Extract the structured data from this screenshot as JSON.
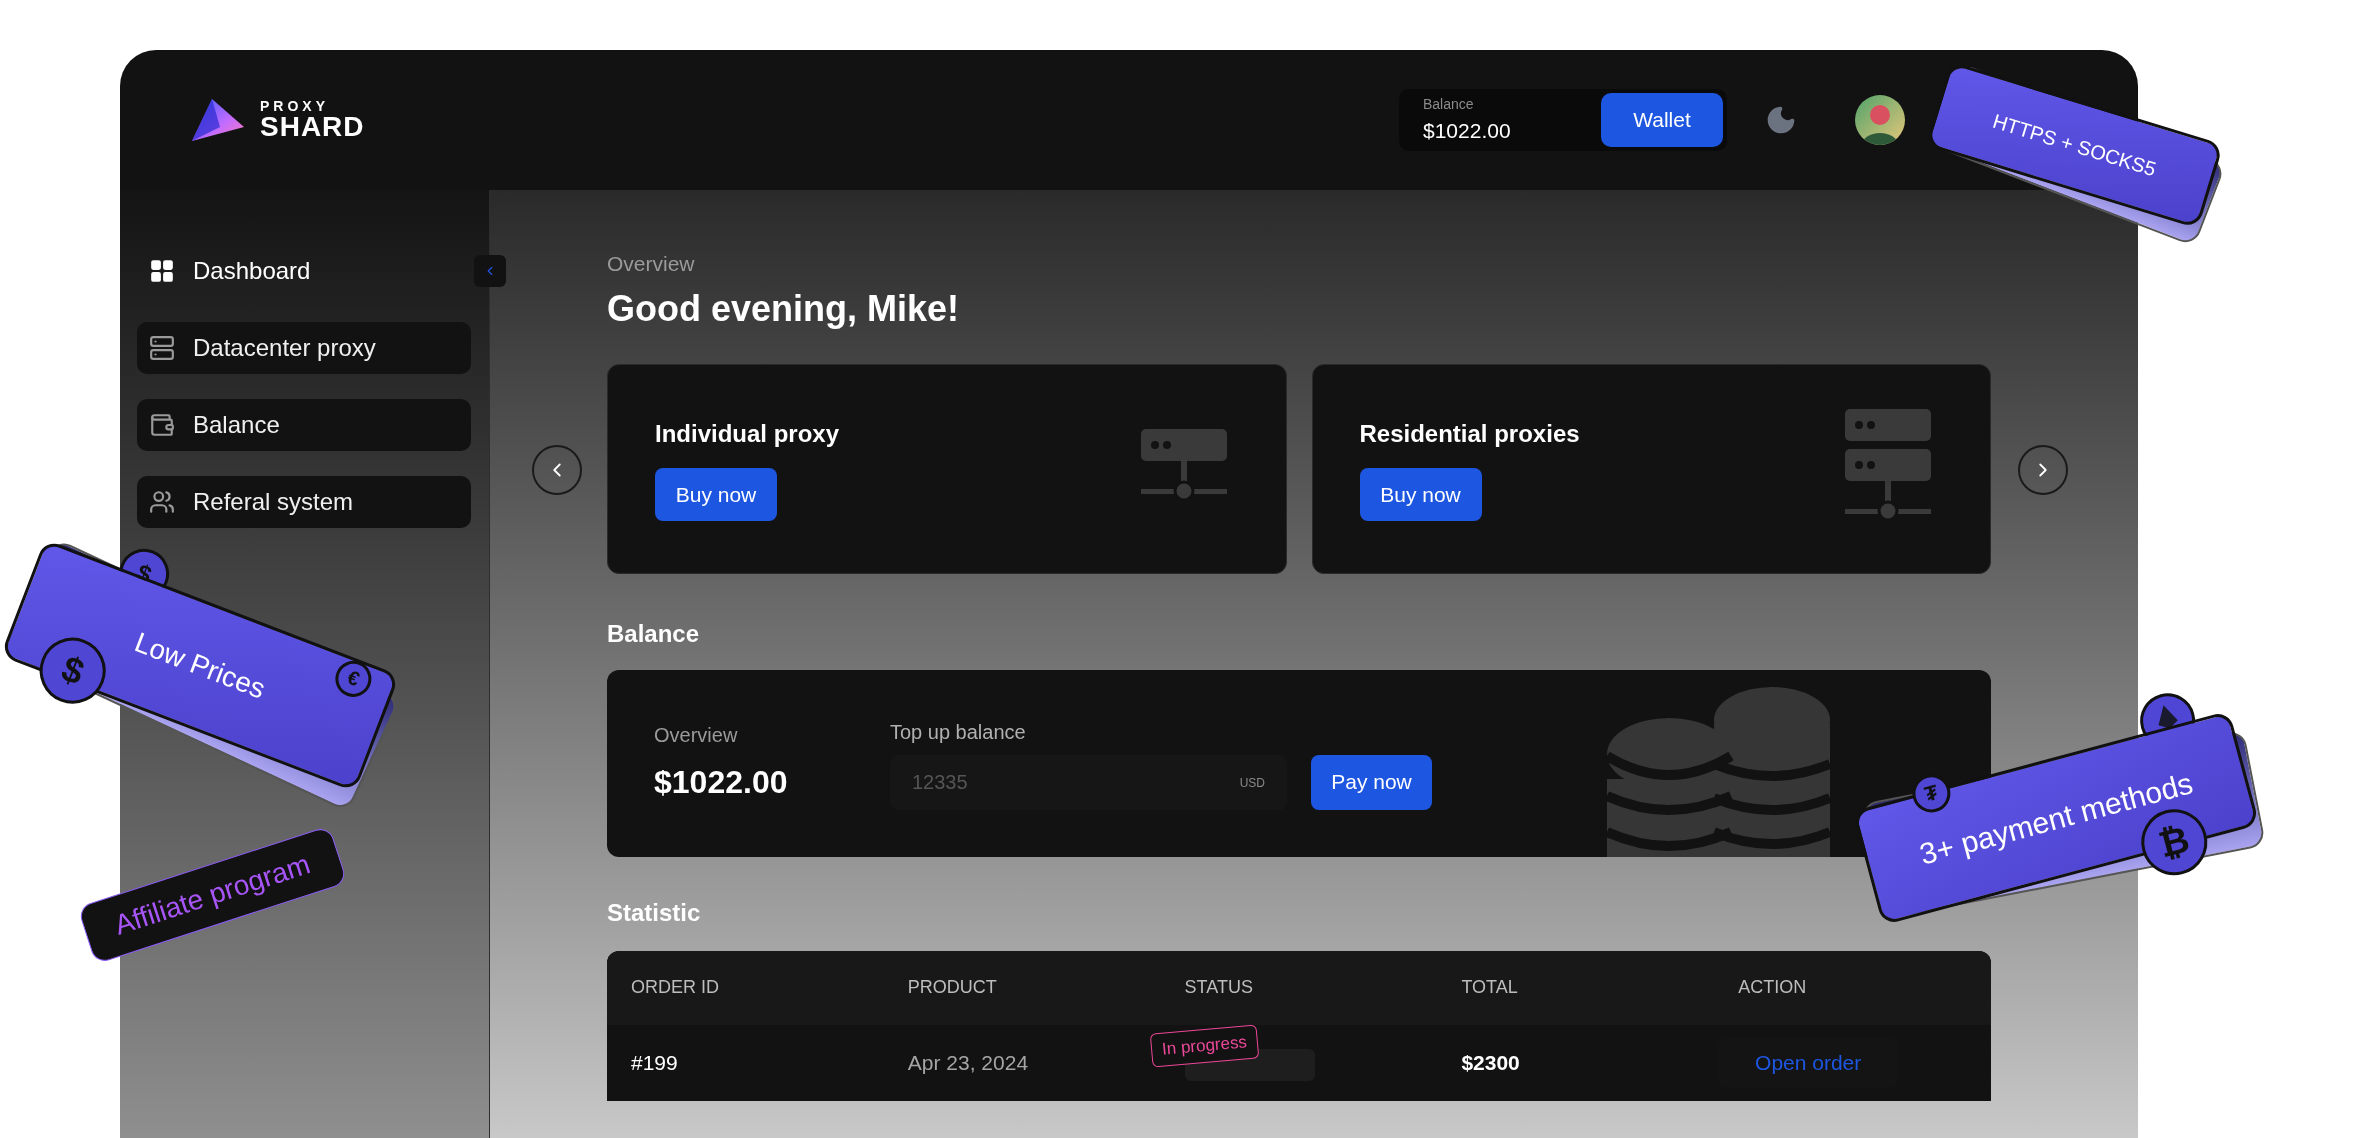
{
  "brand": {
    "small": "PROXY",
    "big": "SHARD"
  },
  "header": {
    "balance_label": "Balance",
    "balance_value": "$1022.00",
    "wallet_button": "Wallet"
  },
  "sidebar": {
    "items": [
      {
        "label": "Dashboard",
        "selected": true,
        "kind": "grid"
      },
      {
        "label": "Datacenter proxy",
        "selected": false,
        "kind": "server"
      },
      {
        "label": "Balance",
        "selected": false,
        "kind": "wallet"
      },
      {
        "label": "Referal system",
        "selected": false,
        "kind": "users"
      }
    ]
  },
  "overview_label": "Overview",
  "greeting": "Good evening, Mike!",
  "products": [
    {
      "title": "Individual proxy",
      "button": "Buy now",
      "kind": "server"
    },
    {
      "title": "Residential proxies",
      "button": "Buy now",
      "kind": "servers"
    }
  ],
  "balance_section": {
    "title": "Balance",
    "overview_label": "Overview",
    "amount": "$1022.00",
    "topup_label": "Top up balance",
    "topup_placeholder": "12335",
    "currency": "USD",
    "pay_button": "Pay now"
  },
  "statistic": {
    "title": "Statistic",
    "columns": [
      "ORDER ID",
      "PRODUCT",
      "STATUS",
      "TOTAL",
      "ACTION"
    ],
    "rows": [
      {
        "order_id": "#199",
        "product": "Apr 23, 2024",
        "status": "In progress",
        "total": "$2300",
        "action": "Open order"
      }
    ]
  },
  "badges": [
    {
      "kind": "plain",
      "text": "HTTPS + SOCKS5"
    },
    {
      "kind": "plain",
      "text": "Low Prices",
      "coins": [
        "$",
        "€",
        "$"
      ]
    },
    {
      "kind": "outline",
      "text": "Affiliate program"
    },
    {
      "kind": "plain",
      "text": "3+ payment methods",
      "coins": [
        "₮",
        "₿"
      ]
    }
  ]
}
